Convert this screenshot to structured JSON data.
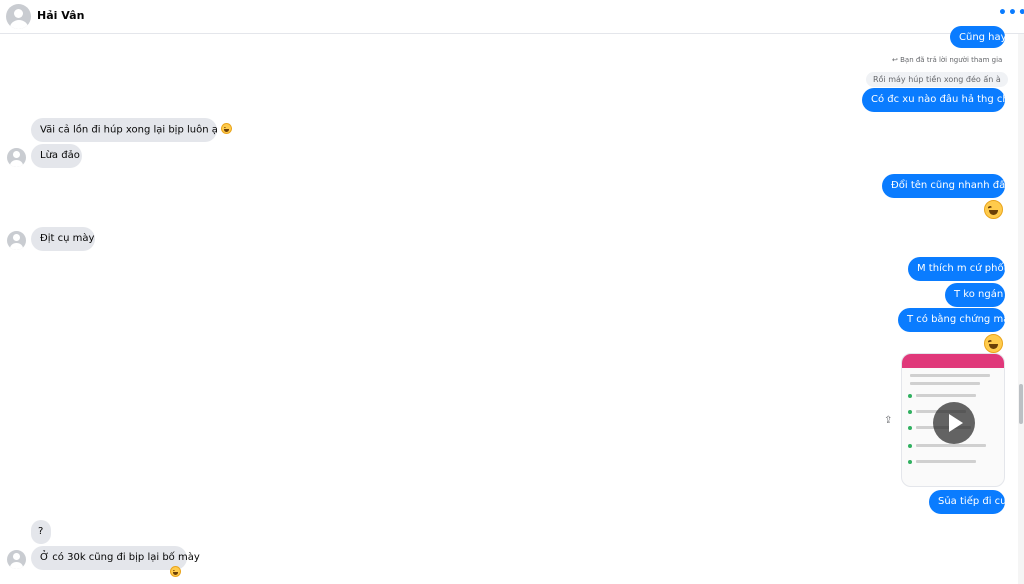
{
  "header": {
    "contact_name": "Hải Vân",
    "more_icon": "more-dots-icon"
  },
  "reply": {
    "meta": "Bạn đã trả lời người tham gia",
    "quoted": "Rồi máy húp tiền xong đéo ấn à"
  },
  "messages": {
    "m1": "Cũng hay",
    "m2": "Có đc xu nào đâu hả thg chó",
    "m3": "Vãi cả lồn đi húp xong lại bịp luôn ạ",
    "m4": "Lừa đảo",
    "m5": "Đổi tên cũng nhanh đấy",
    "m6": "Địt cụ mày",
    "m7": "M thích m cứ phốt",
    "m8": "T ko ngán",
    "m9": "T có bằng chứng mà",
    "m10": "Sủa tiếp đi cu",
    "m11": "?",
    "m12": "Ở có 30k cũng đi bịp lại bố mày"
  },
  "colors": {
    "outgoing": "#0a7cff",
    "incoming": "#e4e6eb",
    "accent": "#0a7cff"
  }
}
